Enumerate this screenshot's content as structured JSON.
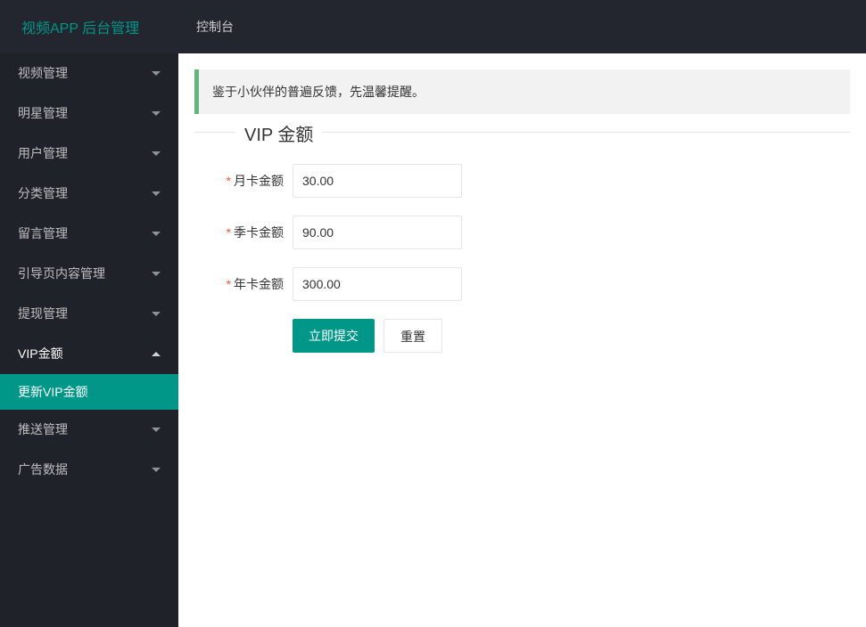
{
  "header": {
    "logo": "视频APP 后台管理",
    "nav": {
      "console": "控制台"
    }
  },
  "sidebar": {
    "items": [
      {
        "label": "视频管理",
        "expanded": false
      },
      {
        "label": "明星管理",
        "expanded": false
      },
      {
        "label": "用户管理",
        "expanded": false
      },
      {
        "label": "分类管理",
        "expanded": false
      },
      {
        "label": "留言管理",
        "expanded": false
      },
      {
        "label": "引导页内容管理",
        "expanded": false
      },
      {
        "label": "提现管理",
        "expanded": false
      },
      {
        "label": "VIP金额",
        "expanded": true,
        "children": [
          {
            "label": "更新VIP金额",
            "active": true
          }
        ]
      },
      {
        "label": "推送管理",
        "expanded": false
      },
      {
        "label": "广告数据",
        "expanded": false
      }
    ]
  },
  "main": {
    "alert": "鉴于小伙伴的普遍反馈，先温馨提醒。",
    "form_title": "VIP 金额",
    "fields": {
      "month": {
        "label": "月卡金额",
        "value": "30.00"
      },
      "quarter": {
        "label": "季卡金额",
        "value": "90.00"
      },
      "year": {
        "label": "年卡金额",
        "value": "300.00"
      }
    },
    "buttons": {
      "submit": "立即提交",
      "reset": "重置"
    }
  }
}
